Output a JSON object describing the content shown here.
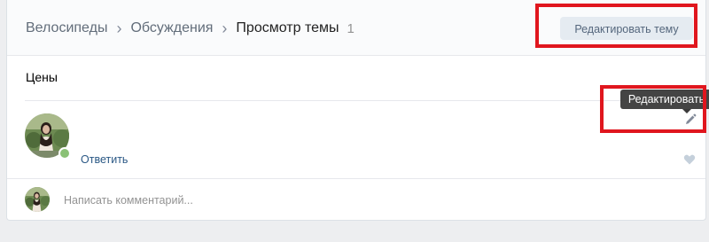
{
  "breadcrumb": {
    "items": [
      "Велосипеды",
      "Обсуждения"
    ],
    "current": "Просмотр темы",
    "count": "1"
  },
  "header": {
    "edit_topic_label": "Редактировать тему"
  },
  "topic": {
    "title": "Цены"
  },
  "post": {
    "reply_label": "Ответить",
    "tooltip": "Редактировать"
  },
  "comment": {
    "placeholder": "Написать комментарий..."
  },
  "colors": {
    "highlight": "#e0161e",
    "link": "#2a5885",
    "online": "#8ac176"
  },
  "icons": {
    "separator": "chevron-right-icon",
    "edit": "pencil-icon",
    "like": "heart-icon"
  }
}
